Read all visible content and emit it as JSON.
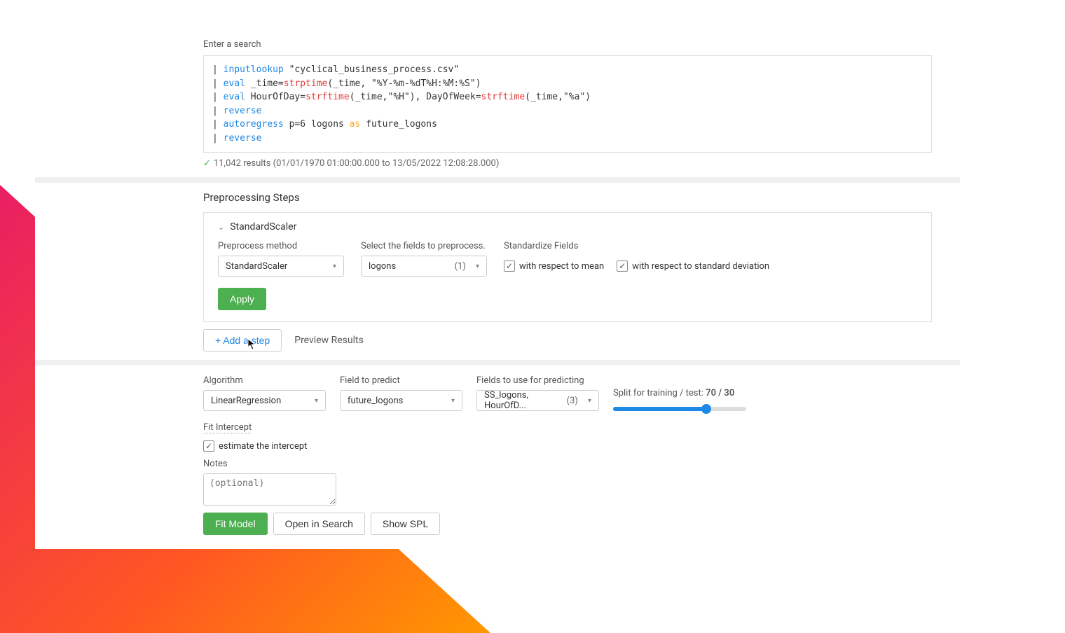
{
  "search": {
    "label": "Enter a search",
    "lines": [
      [
        {
          "t": "pipe",
          "v": "| "
        },
        {
          "t": "cmd",
          "v": "inputlookup "
        },
        {
          "t": "str",
          "v": "\"cyclical_business_process.csv\""
        }
      ],
      [
        {
          "t": "pipe",
          "v": "| "
        },
        {
          "t": "cmd",
          "v": "eval "
        },
        {
          "t": "arg",
          "v": "_time="
        },
        {
          "t": "fn",
          "v": "strptime"
        },
        {
          "t": "arg",
          "v": "(_time, \"%Y-%m-%dT%H:%M:%S\")"
        }
      ],
      [
        {
          "t": "pipe",
          "v": "| "
        },
        {
          "t": "cmd",
          "v": "eval "
        },
        {
          "t": "arg",
          "v": "HourOfDay="
        },
        {
          "t": "fn",
          "v": "strftime"
        },
        {
          "t": "arg",
          "v": "(_time,\"%H\"), DayOfWeek="
        },
        {
          "t": "fn",
          "v": "strftime"
        },
        {
          "t": "arg",
          "v": "(_time,\"%a\")"
        }
      ],
      [
        {
          "t": "pipe",
          "v": "| "
        },
        {
          "t": "cmd",
          "v": "reverse"
        }
      ],
      [
        {
          "t": "pipe",
          "v": "| "
        },
        {
          "t": "cmd",
          "v": "autoregress "
        },
        {
          "t": "arg",
          "v": "p=6 logons "
        },
        {
          "t": "kw",
          "v": "as"
        },
        {
          "t": "arg",
          "v": " future_logons"
        }
      ],
      [
        {
          "t": "pipe",
          "v": "| "
        },
        {
          "t": "cmd",
          "v": "reverse"
        }
      ]
    ],
    "results": "11,042 results (01/01/1970 01:00:00.000 to 13/05/2022 12:08:28.000)"
  },
  "preprocessing": {
    "title": "Preprocessing Steps",
    "stepName": "StandardScaler",
    "methodLabel": "Preprocess method",
    "methodValue": "StandardScaler",
    "fieldsLabel": "Select the fields to preprocess.",
    "fieldsValue": "logons",
    "fieldsCount": "(1)",
    "standardizeLabel": "Standardize Fields",
    "cbMean": "with respect to mean",
    "cbStd": "with respect to standard deviation",
    "apply": "Apply",
    "addStep": "+ Add a step",
    "preview": "Preview Results"
  },
  "algo": {
    "algoLabel": "Algorithm",
    "algoValue": "LinearRegression",
    "predictLabel": "Field to predict",
    "predictValue": "future_logons",
    "useLabel": "Fields to use for predicting",
    "useValue": "SS_logons, HourOfD...",
    "useCount": "(3)",
    "splitLabelPrefix": "Split for training / test: ",
    "splitValue": "70 / 30",
    "splitPercent": 70,
    "fitInterceptLabel": "Fit Intercept",
    "fitInterceptCb": "estimate the intercept",
    "notesLabel": "Notes",
    "notesPlaceholder": "(optional)",
    "fitModel": "Fit Model",
    "openInSearch": "Open in Search",
    "showSPL": "Show SPL"
  }
}
